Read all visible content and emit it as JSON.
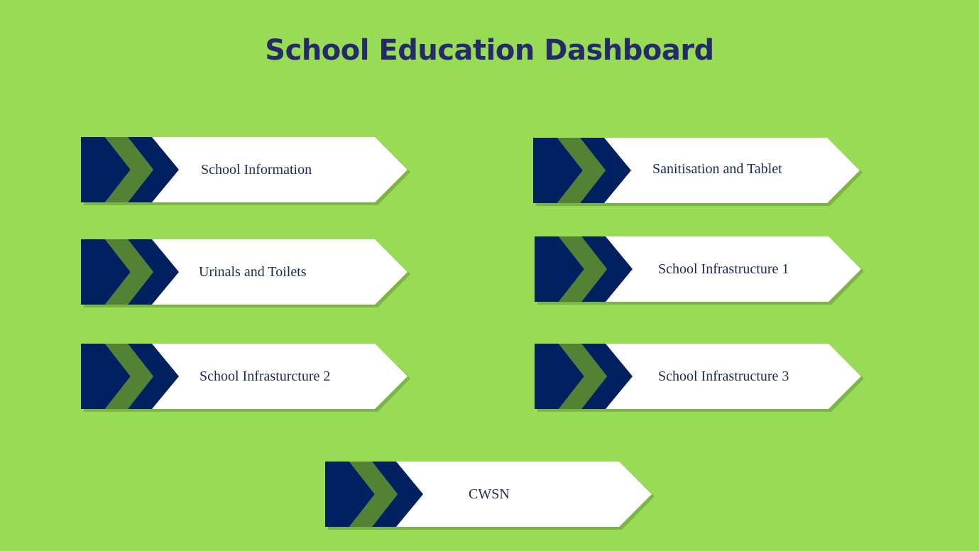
{
  "header": {
    "title": "School Education Dashboard"
  },
  "cards": [
    {
      "label": "School Information"
    },
    {
      "label": "Sanitisation and Tablet"
    },
    {
      "label": "Urinals and Toilets"
    },
    {
      "label": "School Infrastructure 1"
    },
    {
      "label": "School Infrasturcture 2"
    },
    {
      "label": "School Infrastructure 3"
    },
    {
      "label": "CWSN"
    }
  ],
  "colors": {
    "background": "#98dc55",
    "title": "#252a68",
    "chevron_navy": "#00205f",
    "chevron_green": "#548235",
    "card_fill": "#ffffff",
    "label_text": "#1a2b55"
  },
  "icons": {
    "card_marker": "double-chevron-right-icon"
  }
}
